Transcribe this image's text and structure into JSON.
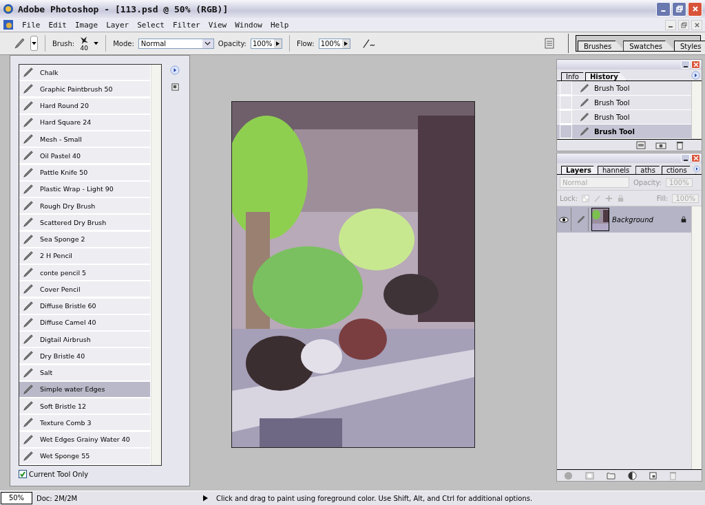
{
  "window": {
    "title": "Adobe Photoshop - [113.psd @ 50% (RGB)]"
  },
  "menu": [
    {
      "label": "File"
    },
    {
      "label": "Edit"
    },
    {
      "label": "Image"
    },
    {
      "label": "Layer"
    },
    {
      "label": "Select"
    },
    {
      "label": "Filter"
    },
    {
      "label": "View"
    },
    {
      "label": "Window"
    },
    {
      "label": "Help"
    }
  ],
  "options": {
    "brush_label": "Brush:",
    "brush_size": "40",
    "mode_label": "Mode:",
    "mode": "Normal",
    "opacity_label": "Opacity:",
    "opacity": "100%",
    "flow_label": "Flow:",
    "flow": "100%"
  },
  "palette_well": [
    {
      "label": "Brushes"
    },
    {
      "label": "Swatches"
    },
    {
      "label": "Styles"
    }
  ],
  "brush_presets": {
    "items": [
      {
        "label": "Chalk",
        "selected": false
      },
      {
        "label": "Graphic Paintbrush 50",
        "selected": false
      },
      {
        "label": "Hard Round 20",
        "selected": false
      },
      {
        "label": "Hard Square 24",
        "selected": false
      },
      {
        "label": "Mesh - Small",
        "selected": false
      },
      {
        "label": "Oil Pastel  40",
        "selected": false
      },
      {
        "label": "Pattle Knife  50",
        "selected": false
      },
      {
        "label": "Plastic Wrap - Light 90",
        "selected": false
      },
      {
        "label": "Rough Dry Brush",
        "selected": false
      },
      {
        "label": "Scattered Dry Brush",
        "selected": false
      },
      {
        "label": "Sea Sponge 2",
        "selected": false
      },
      {
        "label": "2 H Pencil",
        "selected": false
      },
      {
        "label": "conte pencil 5",
        "selected": false
      },
      {
        "label": "Cover Pencil",
        "selected": false
      },
      {
        "label": "Diffuse Bristle 60",
        "selected": false
      },
      {
        "label": "Diffuse Camel 40",
        "selected": false
      },
      {
        "label": "Digtail Airbrush",
        "selected": false
      },
      {
        "label": "Dry  Bristle  40",
        "selected": false
      },
      {
        "label": "Salt",
        "selected": false
      },
      {
        "label": "Simple water Edges",
        "selected": true
      },
      {
        "label": "Soft Bristle 12",
        "selected": false
      },
      {
        "label": "Texture Comb 3",
        "selected": false
      },
      {
        "label": "Wet Edges Grainy Water 40",
        "selected": false
      },
      {
        "label": "Wet Sponge 55",
        "selected": false
      }
    ],
    "current_tool_only": {
      "label": "Current Tool Only",
      "checked": true
    }
  },
  "history_panel": {
    "tabs": [
      {
        "label": "Info",
        "selected": false
      },
      {
        "label": "History",
        "selected": true
      }
    ],
    "items": [
      {
        "label": "Brush Tool",
        "selected": false
      },
      {
        "label": "Brush Tool",
        "selected": false
      },
      {
        "label": "Brush Tool",
        "selected": false
      },
      {
        "label": "Brush Tool",
        "selected": true
      }
    ]
  },
  "layers_panel": {
    "tabs": [
      {
        "label": "Layers",
        "selected": true
      },
      {
        "label": "hannels",
        "selected": false
      },
      {
        "label": "aths",
        "selected": false
      },
      {
        "label": "ctions",
        "selected": false
      }
    ],
    "blend_mode": "Normal",
    "opacity_label": "Opacity:",
    "opacity": "100%",
    "lock_label": "Lock:",
    "fill_label": "Fill:",
    "fill": "100%",
    "layers": [
      {
        "name": "Background",
        "visible": true,
        "locked": true
      }
    ]
  },
  "status_bar": {
    "zoom": "50%",
    "doc": "Doc: 2M/2M",
    "hint": "Click and drag to paint using foreground color.  Use Shift, Alt, and Ctrl for additional options."
  }
}
